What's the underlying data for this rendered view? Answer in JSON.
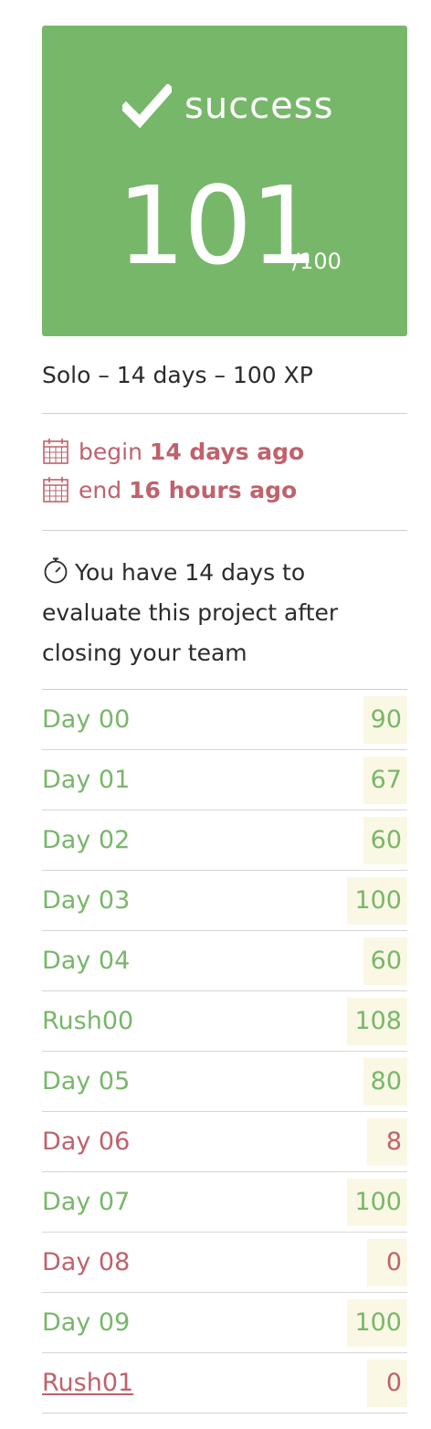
{
  "colors": {
    "success": "#77b769",
    "fail": "#c0616c",
    "score_background": "#faf8e4"
  },
  "result": {
    "status_icon": "check-icon",
    "status": "success",
    "mark": "101",
    "max_mark": "/100"
  },
  "project_meta": "Solo – 14 days – 100 XP",
  "dates": {
    "begin_icon": "calendar-icon",
    "begin_label": "begin",
    "begin_value": "14 days ago",
    "end_icon": "calendar-icon",
    "end_label": "end",
    "end_value": "16 hours ago"
  },
  "evaluation_notice": {
    "icon": "stopwatch-icon",
    "text": "You have 14 days to evaluate this project after closing your team"
  },
  "projects": [
    {
      "name": "Day 00",
      "score": "90",
      "status": "success"
    },
    {
      "name": "Day 01",
      "score": "67",
      "status": "success"
    },
    {
      "name": "Day 02",
      "score": "60",
      "status": "success"
    },
    {
      "name": "Day 03",
      "score": "100",
      "status": "success"
    },
    {
      "name": "Day 04",
      "score": "60",
      "status": "success"
    },
    {
      "name": "Rush00",
      "score": "108",
      "status": "success"
    },
    {
      "name": "Day 05",
      "score": "80",
      "status": "success"
    },
    {
      "name": "Day 06",
      "score": "8",
      "status": "fail"
    },
    {
      "name": "Day 07",
      "score": "100",
      "status": "success"
    },
    {
      "name": "Day 08",
      "score": "0",
      "status": "fail"
    },
    {
      "name": "Day 09",
      "score": "100",
      "status": "success"
    },
    {
      "name": "Rush01",
      "score": "0",
      "status": "fail",
      "link": true
    }
  ]
}
